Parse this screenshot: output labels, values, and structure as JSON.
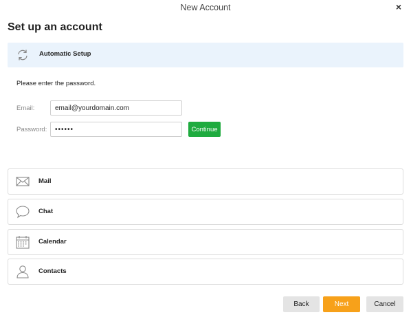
{
  "window": {
    "title": "New Account",
    "close_glyph": "×"
  },
  "page": {
    "heading": "Set up an account"
  },
  "auto_setup": {
    "label": "Automatic Setup",
    "icon": "sync-icon",
    "background": "#eaf3fc"
  },
  "form": {
    "prompt": "Please enter the password.",
    "email_label": "Email:",
    "email_value": "email@yourdomain.com",
    "password_label": "Password:",
    "password_value": "••••••",
    "continue_label": "Continue",
    "continue_color": "#1fab3f"
  },
  "services": [
    {
      "label": "Mail",
      "icon": "envelope-icon"
    },
    {
      "label": "Chat",
      "icon": "chat-bubble-icon"
    },
    {
      "label": "Calendar",
      "icon": "calendar-icon"
    },
    {
      "label": "Contacts",
      "icon": "person-icon"
    }
  ],
  "footer": {
    "back_label": "Back",
    "next_label": "Next",
    "cancel_label": "Cancel",
    "next_color": "#f7a11a"
  }
}
